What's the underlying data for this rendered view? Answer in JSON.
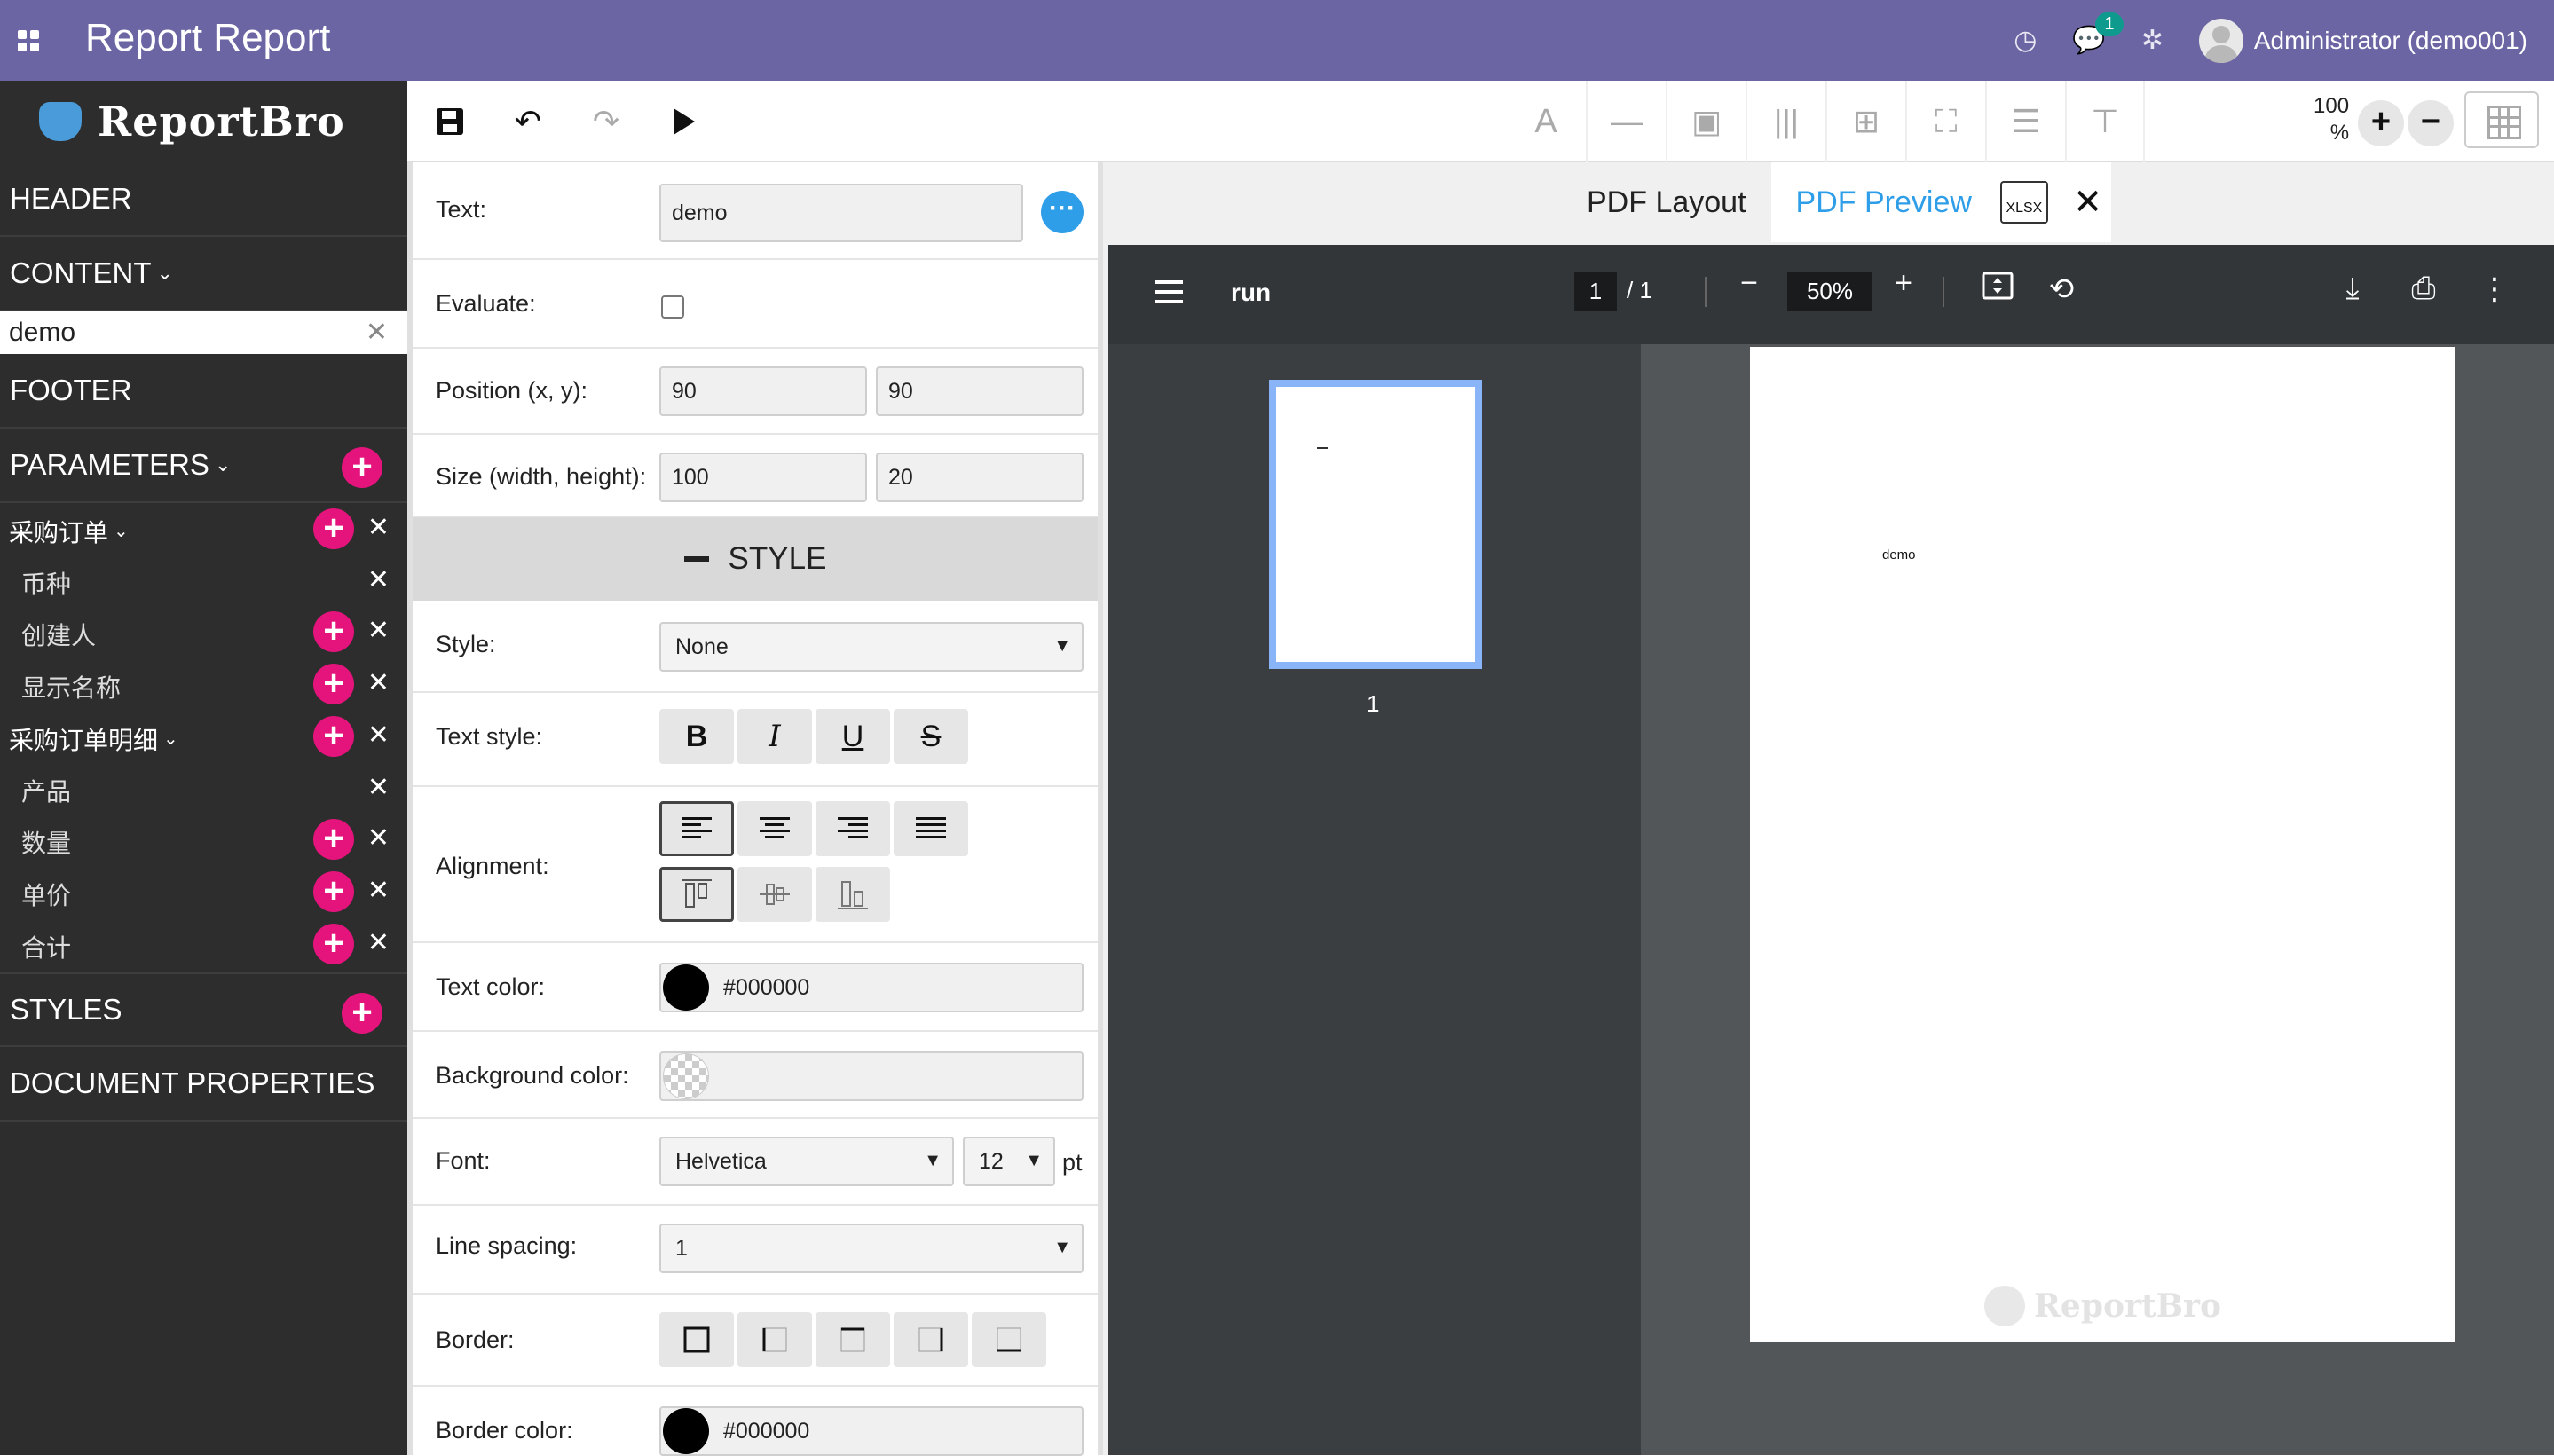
{
  "topbar": {
    "title": "Report Report",
    "chat_badge": "1",
    "user": "Administrator (demo001)",
    "icons": [
      "apps-icon",
      "clock-icon",
      "chat-icon",
      "bug-icon",
      "avatar"
    ]
  },
  "sidebar": {
    "logo_text": "ReportBro",
    "header": "HEADER",
    "content": "CONTENT",
    "content_item": "demo",
    "footer": "FOOTER",
    "parameters": "PARAMETERS",
    "params": [
      {
        "label": "采购订单",
        "level": 1,
        "expandable": true,
        "add": true
      },
      {
        "label": "币种",
        "level": 2,
        "add": false
      },
      {
        "label": "创建人",
        "level": 2,
        "add": true
      },
      {
        "label": "显示名称",
        "level": 2,
        "add": true
      },
      {
        "label": "采购订单明细",
        "level": 1,
        "expandable": true,
        "add": true
      },
      {
        "label": "产品",
        "level": 2,
        "add": false
      },
      {
        "label": "数量",
        "level": 2,
        "add": true
      },
      {
        "label": "单价",
        "level": 2,
        "add": true
      },
      {
        "label": "合计",
        "level": 2,
        "add": true
      }
    ],
    "styles": "STYLES",
    "document_properties": "DOCUMENT PROPERTIES"
  },
  "toolbar": {
    "zoom_value": "100",
    "zoom_unit": "%",
    "tools": [
      "text-tool-icon",
      "line-tool-icon",
      "image-tool-icon",
      "barcode-tool-icon",
      "table-tool-icon",
      "frame-tool-icon",
      "section-tool-icon",
      "page-break-tool-icon"
    ]
  },
  "props": {
    "text_label": "Text:",
    "text_value": "demo",
    "evaluate_label": "Evaluate:",
    "position_label": "Position (x, y):",
    "position_x": "90",
    "position_y": "90",
    "size_label": "Size (width, height):",
    "size_w": "100",
    "size_h": "20",
    "style_section": "STYLE",
    "style_label": "Style:",
    "style_value": "None",
    "text_style_label": "Text style:",
    "alignment_label": "Alignment:",
    "text_color_label": "Text color:",
    "text_color_value": "#000000",
    "bg_color_label": "Background color:",
    "bg_color_value": "",
    "font_label": "Font:",
    "font_value": "Helvetica",
    "font_size": "12",
    "font_unit": "pt",
    "line_spacing_label": "Line spacing:",
    "line_spacing_value": "1",
    "border_label": "Border:",
    "border_color_label": "Border color:",
    "border_color_value": "#000000"
  },
  "preview": {
    "tab_layout": "PDF Layout",
    "tab_preview": "PDF Preview",
    "xlsx_label": "XLSX",
    "viewer_title": "run",
    "page_current": "1",
    "page_total": "/  1",
    "zoom": "50%",
    "thumb_number": "1",
    "page_text": "demo",
    "watermark": "ReportBro"
  },
  "colors": {
    "topbar": "#6b66a3",
    "sidebar": "#2d2d2d",
    "add_button": "#e4147c",
    "accent_blue": "#2f9ee8",
    "viewer_bg": "#525659",
    "viewer_toolbar": "#323639"
  }
}
